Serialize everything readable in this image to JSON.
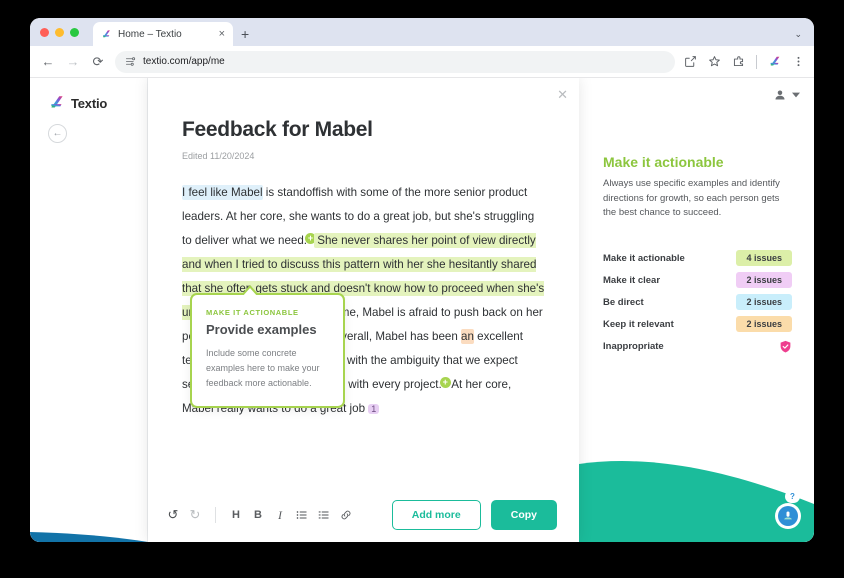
{
  "browser": {
    "tab": {
      "title": "Home – Textio",
      "favicon_icon": "textio-logo-icon",
      "close_icon": "×"
    },
    "new_tab_icon": "+",
    "tabstrip_chevron_icon": "⌄",
    "nav": {
      "back_icon": "←",
      "forward_icon": "→",
      "reload_icon": "⟳"
    },
    "url": "textio.com/app/me",
    "omni_icons": [
      "share-icon",
      "bookmark-star-icon",
      "extensions-icon",
      "profile-logo-icon",
      "kebab-menu-icon"
    ]
  },
  "app": {
    "brand_name": "Textio",
    "back_icon": "←",
    "avatar_icon": "user-avatar",
    "avatar_chevron": "▾"
  },
  "document": {
    "close_icon": "✕",
    "title": "Feedback for Mabel",
    "edited": "Edited 11/20/2024",
    "paragraph": {
      "s1": "I feel like Mabel",
      "s2": " is standoffish with some of the more senior product leaders. At her core, she wants to do a great job, but she's struggling to deliver what we need.",
      "s3": " She never shares her point of view directly and when I tried to discuss this pattern with her she hesitantly shared that she often gets stuck and doesn't know how to proceed when she's under pressure.",
      "s4": " Most of the time, Mabel is afraid to push back on her peers in her current position. Overall, Mabel has been ",
      "s5": "an",
      "s6": " excellent team member, dealing this year with the ambiguity that we expect senior team members to handle with every project.",
      "s7": " At her core, Mabel really wants to do a great job ",
      "s8": "1"
    },
    "marker_icon": "+",
    "tooltip": {
      "kicker": "MAKE IT ACTIONABLE",
      "title": "Provide examples",
      "description": "Include some concrete examples here to make your feedback more actionable."
    },
    "toolbar": {
      "undo_icon": "↺",
      "redo_icon": "↻",
      "heading_icon": "H",
      "bold_icon": "B",
      "italic_icon": "I",
      "bullet_list_icon": "☰",
      "number_list_icon": "☷",
      "link_icon": "🔗",
      "add_more_label": "Add more",
      "copy_label": "Copy"
    }
  },
  "panel": {
    "heading": "Make it actionable",
    "description": "Always use specific examples and identify directions for growth, so each person gets the best chance to succeed.",
    "scores": [
      {
        "label": "Make it actionable",
        "value": "4 issues",
        "color": "#dcefa8"
      },
      {
        "label": "Make it clear",
        "value": "2 issues",
        "color": "#f0cdf5"
      },
      {
        "label": "Be direct",
        "value": "2 issues",
        "color": "#c9eefb"
      },
      {
        "label": "Keep it relevant",
        "value": "2 issues",
        "color": "#fbdcaa"
      },
      {
        "label": "Inappropriate",
        "value": "",
        "color": ""
      }
    ],
    "inappropriate_icon": "shield-check-icon",
    "accent_green": "#8cc63e",
    "wave_teal": "#1bbc9b"
  },
  "help": {
    "bubble_icon": "?",
    "widget_icon": "chat-avatar-icon"
  }
}
